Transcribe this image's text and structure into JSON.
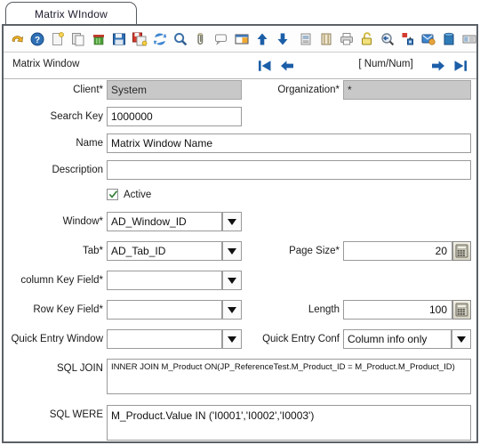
{
  "tab": {
    "label": "Matrix WIndow"
  },
  "toolbar": {
    "buttons": [
      {
        "name": "undo-icon",
        "title": "Undo"
      },
      {
        "name": "help-icon",
        "title": "Help"
      },
      {
        "name": "new-record-icon",
        "title": "New Record"
      },
      {
        "name": "copy-record-icon",
        "title": "Copy Record"
      },
      {
        "name": "delete-record-icon",
        "title": "Delete Record"
      },
      {
        "name": "save-icon",
        "title": "Save"
      },
      {
        "name": "save-create-new-icon",
        "title": "Save and Create New"
      },
      {
        "name": "refresh-icon",
        "title": "Refresh"
      },
      {
        "name": "find-icon",
        "title": "Find"
      },
      {
        "name": "attachment-icon",
        "title": "Attachment"
      },
      {
        "name": "chat-icon",
        "title": "Chat"
      },
      {
        "name": "grid-toggle-icon",
        "title": "Grid Toggle"
      },
      {
        "name": "parent-up-icon",
        "title": "Parent Record"
      },
      {
        "name": "detail-down-icon",
        "title": "Detail Record"
      },
      {
        "name": "history-icon",
        "title": "History Records"
      },
      {
        "name": "archive-icon",
        "title": "Archived Documents"
      },
      {
        "name": "print-icon",
        "title": "Print"
      },
      {
        "name": "lock-icon",
        "title": "Lock Record"
      },
      {
        "name": "zoom-across-icon",
        "title": "Zoom Across"
      },
      {
        "name": "active-workflow-icon",
        "title": "Active Workflow"
      },
      {
        "name": "request-icon",
        "title": "Requests"
      },
      {
        "name": "product-info-icon",
        "title": "Product Info"
      },
      {
        "name": "report-icon",
        "title": "Report"
      },
      {
        "name": "preference-icon",
        "title": "Preference"
      },
      {
        "name": "export-icon",
        "title": "Export"
      },
      {
        "name": "exit-icon",
        "title": "Exit"
      }
    ]
  },
  "nav": {
    "title": "Matrix Window",
    "counter": "[ Num/Num]",
    "first_icon": "nav-first-icon",
    "prev_icon": "nav-previous-icon",
    "next_icon": "nav-next-icon",
    "last_icon": "nav-last-icon"
  },
  "form": {
    "client": {
      "label": "Client*",
      "value": "System"
    },
    "organization": {
      "label": "Organization*",
      "value": "*"
    },
    "search_key": {
      "label": "Search Key",
      "value": "1000000"
    },
    "name": {
      "label": "Name",
      "value": "Matrix Window Name"
    },
    "description": {
      "label": "Description",
      "value": ""
    },
    "active": {
      "label": "Active",
      "checked": true
    },
    "window": {
      "label": "Window*",
      "value": "AD_Window_ID"
    },
    "tab": {
      "label": "Tab*",
      "value": "AD_Tab_ID"
    },
    "page_size": {
      "label": "Page Size*",
      "value": "20"
    },
    "column_key": {
      "label": "column Key Field*",
      "value": ""
    },
    "row_key": {
      "label": "Row Key Field*",
      "value": ""
    },
    "length": {
      "label": "Length",
      "value": "100"
    },
    "quick_window": {
      "label": "Quick Entry Window",
      "value": ""
    },
    "quick_conf": {
      "label": "Quick Entry Conf",
      "value": "Column info only"
    },
    "sql_join": {
      "label": "SQL JOIN",
      "value": "INNER JOIN M_Product ON(JP_ReferenceTest.M_Product_ID = M_Product.M_Product_ID)"
    },
    "sql_were": {
      "label": "SQL WERE",
      "value": "M_Product.Value IN ('I0001','I0002','I0003')"
    }
  },
  "colors": {
    "accent_blue": "#1c5ea8",
    "disabled_bg": "#c8c8c8",
    "border": "#5c6166",
    "field_border": "#9a9a9a"
  }
}
